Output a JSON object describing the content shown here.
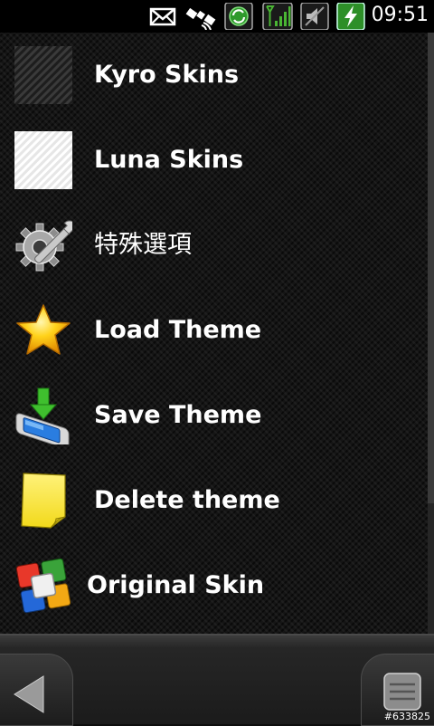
{
  "status_bar": {
    "time": "09:51",
    "icons": [
      "mail-icon",
      "satellite-icon",
      "sync-icon",
      "signal-icon",
      "volume-icon",
      "battery-charging-icon"
    ]
  },
  "menu": {
    "items": [
      {
        "label": "Kyro Skins",
        "icon": "carbon-swatch-icon"
      },
      {
        "label": "Luna Skins",
        "icon": "white-swatch-icon"
      },
      {
        "label": "特殊選項",
        "icon": "gear-wrench-icon"
      },
      {
        "label": "Load Theme",
        "icon": "star-icon"
      },
      {
        "label": "Save Theme",
        "icon": "download-device-icon"
      },
      {
        "label": "Delete theme",
        "icon": "sticky-note-icon"
      },
      {
        "label": "Original Skin",
        "icon": "windows-logo-icon"
      }
    ]
  },
  "bottom_bar": {
    "back_icon": "back-arrow-icon",
    "menu_icon": "menu-list-icon"
  },
  "watermark": "#633825",
  "colors": {
    "accent_green": "#4ab534",
    "label": "#ffffff"
  }
}
